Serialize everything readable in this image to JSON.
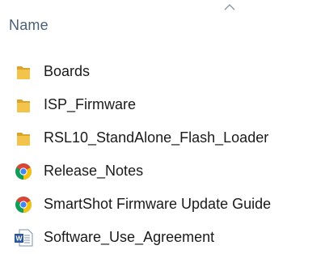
{
  "header": {
    "column_label": "Name",
    "sort_icon": "chevron-up-icon"
  },
  "files": [
    {
      "label": "Boards",
      "icon": "folder-icon"
    },
    {
      "label": "ISP_Firmware",
      "icon": "folder-icon"
    },
    {
      "label": "RSL10_StandAlone_Flash_Loader",
      "icon": "folder-icon"
    },
    {
      "label": "Release_Notes",
      "icon": "chrome-icon"
    },
    {
      "label": "SmartShot Firmware Update Guide",
      "icon": "chrome-icon"
    },
    {
      "label": "Software_Use_Agreement",
      "icon": "word-document-icon"
    }
  ],
  "colors": {
    "header_text": "#4a5f7a",
    "item_text": "#1a1a1a",
    "folder": "#f3c44b",
    "folder_dark": "#dba42a",
    "chrome_red": "#db4437",
    "chrome_yellow": "#f4c20d",
    "chrome_green": "#0f9d58",
    "chrome_blue": "#4285f4",
    "word_blue": "#2b579a"
  }
}
